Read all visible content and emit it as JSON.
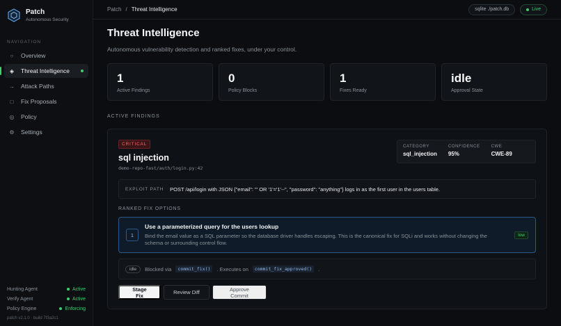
{
  "brand": {
    "name": "Patch",
    "subtitle": "Autonomous Security"
  },
  "nav": {
    "heading": "NAVIGATION",
    "items": [
      {
        "label": "Overview",
        "icon": "circle-icon"
      },
      {
        "label": "Threat Intelligence",
        "icon": "diamond-icon"
      },
      {
        "label": "Attack Paths",
        "icon": "arrow-right-icon"
      },
      {
        "label": "Fix Proposals",
        "icon": "square-icon"
      },
      {
        "label": "Policy",
        "icon": "target-icon"
      },
      {
        "label": "Settings",
        "icon": "gear-icon"
      }
    ]
  },
  "agents": [
    {
      "name": "Hunting Agent",
      "status": "Active"
    },
    {
      "name": "Verify Agent",
      "status": "Active"
    },
    {
      "name": "Policy Engine",
      "status": "Enforcing"
    }
  ],
  "version": "patch v2.1.0 · build 7f3a2c1",
  "breadcrumb": {
    "root": "Patch",
    "sep": "/",
    "current": "Threat Intelligence"
  },
  "topbar": {
    "db": "sqlite ./patch.db",
    "live": "Live"
  },
  "page": {
    "title": "Threat Intelligence",
    "subtitle": "Autonomous vulnerability detection and ranked fixes, under your control."
  },
  "stats": [
    {
      "value": "1",
      "label": "Active Findings"
    },
    {
      "value": "0",
      "label": "Policy Blocks"
    },
    {
      "value": "1",
      "label": "Fixes Ready"
    },
    {
      "value": "idle",
      "label": "Approval State"
    }
  ],
  "findings_heading": "ACTIVE FINDINGS",
  "finding": {
    "severity": "CRITICAL",
    "title": "sql injection",
    "path": "demo-repo-fast/auth/login.py:42",
    "meta": [
      {
        "key": "CATEGORY",
        "value": "sql_injection"
      },
      {
        "key": "CONFIDENCE",
        "value": "95%"
      },
      {
        "key": "CWE",
        "value": "CWE-89"
      }
    ],
    "exploit_label": "EXPLOIT PATH",
    "exploit": "POST /api/login with JSON {\"email\": \"' OR '1'='1'--\", \"password\": \"anything\"} logs in as the first user in the users table."
  },
  "ranked_heading": "RANKED FIX OPTIONS",
  "fix": {
    "rank": "1",
    "title": "Use a parameterized query for the users lookup",
    "description": "Bind the email value as a SQL parameter so the database driver handles escaping. This is the canonical fix for SQLi and works without changing the schema or surrounding control flow.",
    "risk": "low"
  },
  "approval": {
    "state": "idle",
    "text1": "Blocked via",
    "code1": "commit_fix()",
    "text2": ". Executes on",
    "code2": "commit_fix_approved()",
    "text3": "."
  },
  "actions": {
    "stage": "Stage Fix",
    "review": "Review Diff",
    "approve": "Approve Commit"
  }
}
